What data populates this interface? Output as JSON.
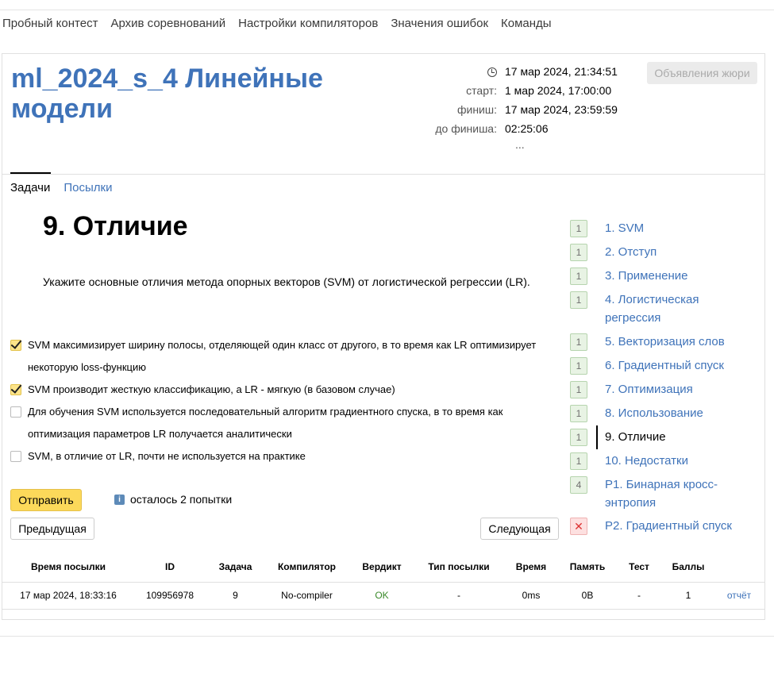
{
  "topnav": [
    "Пробный контест",
    "Архив соревнований",
    "Настройки компиляторов",
    "Значения ошибок",
    "Команды"
  ],
  "contest": {
    "title": "ml_2024_s_4 Линейные модели",
    "now_time": "17 мар 2024, 21:34:51",
    "start_label": "старт:",
    "start_value": "1 мар 2024, 17:00:00",
    "finish_label": "финиш:",
    "finish_value": "17 мар 2024, 23:59:59",
    "left_label": "до финиша:",
    "left_value": "02:25:06",
    "more": "...",
    "announce_button": "Объявления жюри"
  },
  "tabs": {
    "tasks": "Задачи",
    "submissions": "Посылки"
  },
  "problem": {
    "title": "9. Отличие",
    "statement": "Укажите основные отличия метода опорных векторов (SVM) от логистической регрессии (LR).",
    "options": [
      {
        "text": "SVM максимизирует ширину полосы, отделяющей один класс от другого, в то время как LR оптимизирует некоторую loss-функцию",
        "checked": true
      },
      {
        "text": "SVM производит жесткую классификацию, а LR - мягкую (в базовом случае)",
        "checked": true
      },
      {
        "text": "Для обучения SVM используется последовательный алгоритм градиентного спуска, в то время как оптимизация параметров LR получается аналитически",
        "checked": false
      },
      {
        "text": "SVM, в отличие от LR, почти не используется на практике",
        "checked": false
      }
    ],
    "submit": "Отправить",
    "attempts": "осталось 2 попытки",
    "info": "i",
    "prev": "Предыдущая",
    "next": "Следующая"
  },
  "problems": [
    {
      "badge": "1",
      "label": "1. SVM"
    },
    {
      "badge": "1",
      "label": "2. Отступ"
    },
    {
      "badge": "1",
      "label": "3. Применение"
    },
    {
      "badge": "1",
      "label": "4. Логистическая регрессия"
    },
    {
      "badge": "1",
      "label": "5. Векторизация слов"
    },
    {
      "badge": "1",
      "label": "6. Градиентный спуск"
    },
    {
      "badge": "1",
      "label": "7. Оптимизация"
    },
    {
      "badge": "1",
      "label": "8. Использование"
    },
    {
      "badge": "1",
      "label": "9. Отличие"
    },
    {
      "badge": "1",
      "label": "10. Недостатки"
    },
    {
      "badge": "4",
      "label": "P1. Бинарная кросс-энтропия"
    },
    {
      "badge": "✕",
      "label": "P2. Градиентный спуск"
    }
  ],
  "submissions": {
    "headers": [
      "Время посылки",
      "ID",
      "Задача",
      "Компилятор",
      "Вердикт",
      "Тип посылки",
      "Время",
      "Память",
      "Тест",
      "Баллы",
      ""
    ],
    "rows": [
      [
        "17 мар 2024, 18:33:16",
        "109956978",
        "9",
        "No-compiler",
        "OK",
        "-",
        "0ms",
        "0B",
        "-",
        "1",
        "отчёт"
      ]
    ]
  }
}
